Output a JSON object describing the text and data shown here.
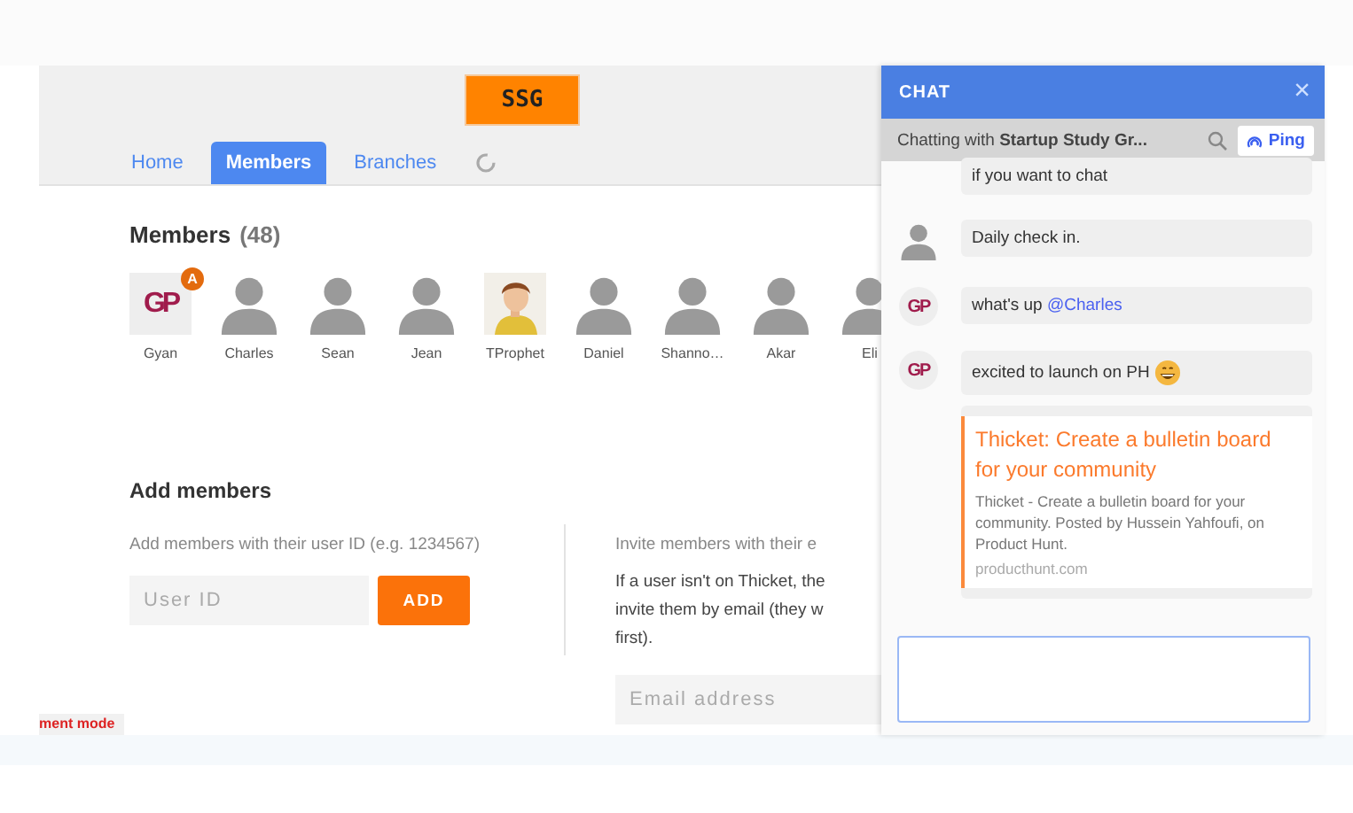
{
  "logo": {
    "text": "SSG"
  },
  "tabs": [
    {
      "label": "Home",
      "selected": false
    },
    {
      "label": "Members",
      "selected": true
    },
    {
      "label": "Branches",
      "selected": false
    }
  ],
  "members": {
    "title": "Members",
    "count": "(48)",
    "items": [
      {
        "name": "Gyan",
        "kind": "logo",
        "logo_text": "GP",
        "badge": "A"
      },
      {
        "name": "Charles",
        "kind": "silhouette"
      },
      {
        "name": "Sean",
        "kind": "silhouette"
      },
      {
        "name": "Jean",
        "kind": "silhouette"
      },
      {
        "name": "TProphet",
        "kind": "photo"
      },
      {
        "name": "Daniel",
        "kind": "silhouette"
      },
      {
        "name": "Shanno…",
        "kind": "silhouette"
      },
      {
        "name": "Akar",
        "kind": "silhouette"
      },
      {
        "name": "Eli",
        "kind": "silhouette"
      }
    ]
  },
  "add_members": {
    "title": "Add members",
    "by_id_hint": "Add members with their user ID (e.g. 1234567)",
    "user_id_placeholder": "User ID",
    "add_button": "ADD",
    "invite_hint": "Invite members with their e",
    "invite_note_lines": [
      "If a user isn't on Thicket, the",
      "invite them by email (they w",
      "first)."
    ],
    "email_placeholder": "Email address"
  },
  "mode_badge": "ment mode",
  "chat": {
    "title": "CHAT",
    "close": "×",
    "subtitle": "Chatting with **Startup Study Gr...**",
    "ping": "Ping",
    "messages": [
      {
        "kind": "continued",
        "text": "if you want to chat"
      },
      {
        "kind": "silhouette",
        "text": "Daily check in."
      },
      {
        "kind": "logo",
        "logo_text": "GP",
        "text": "what's up ",
        "mention": "@Charles"
      },
      {
        "kind": "logo",
        "logo_text": "GP",
        "text": "excited to launch on PH",
        "emoji": true,
        "link": {
          "title": "Thicket: Create a bulletin board for your community",
          "description": "Thicket - Create a bulletin board for your community. Posted by Hussein Yahfoufi, on Product Hunt.",
          "domain": "producthunt.com"
        }
      }
    ]
  }
}
